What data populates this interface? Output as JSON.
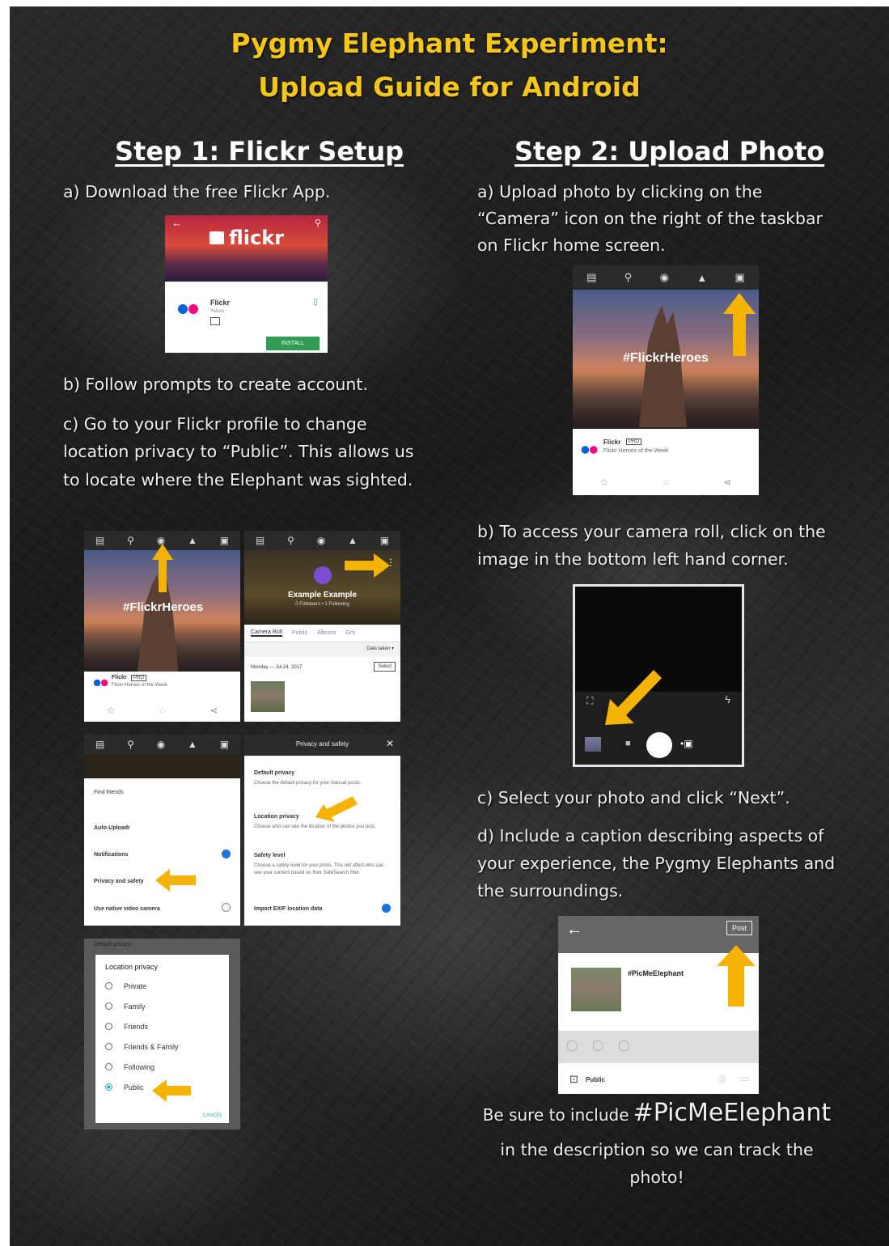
{
  "title": {
    "line1": "Pygmy Elephant Experiment:",
    "line2": "Upload Guide for Android"
  },
  "step1": {
    "heading": "Step 1: Flickr Setup",
    "a": "a) Download the free Flickr App.",
    "b": "b) Follow prompts to create account.",
    "c_lines": [
      "c) Go to your Flickr profile to change",
      "location privacy to “Public”. This allows us",
      "to locate where the Elephant was sighted."
    ],
    "app_store": {
      "logo": "flickr",
      "app_name": "Flickr",
      "publisher": "Yahoo",
      "install": "INSTALL"
    },
    "feed": {
      "hashtag": "#FlickrHeroes",
      "account": "Flickr",
      "badge": "PRO",
      "subtitle": "Flickr Heroes of the Week"
    },
    "profile": {
      "name": "Example Example",
      "stats": "0 Followers • 1 Following",
      "tabs": [
        "Camera Roll",
        "Public",
        "Albums",
        "Gro"
      ],
      "sort": "Date taken ▾",
      "date": "Monday — Jul 24, 2017",
      "select": "Select"
    },
    "menu": {
      "items": [
        "Find friends",
        "Auto-Uploadr",
        "Notifications",
        "Privacy and safety",
        "Use native video camera"
      ]
    },
    "privacy": {
      "header": "Privacy and safety",
      "default_title": "Default privacy",
      "default_desc": "Choose the default privacy for your manual posts.",
      "location_title": "Location privacy",
      "location_desc": "Choose who can see the location of the photos you post.",
      "safety_title": "Safety level",
      "safety_desc": "Choose a safety level for your posts. This will affect who can see your content based on their SafeSearch filter.",
      "exif": "Import EXIF location data"
    },
    "location_dialog": {
      "backdrop": "Default privacy",
      "title": "Location privacy",
      "options": [
        "Private",
        "Family",
        "Friends",
        "Friends & Family",
        "Following",
        "Public"
      ],
      "selected": "Public",
      "cancel": "CANCEL"
    }
  },
  "step2": {
    "heading": "Step 2: Upload Photo",
    "a_lines": [
      "a) Upload photo by clicking on the",
      "“Camera” icon on the right of the taskbar",
      "on Flickr home screen."
    ],
    "b_lines": [
      "b) To access your camera roll, click on the",
      "image in the bottom left hand corner."
    ],
    "c": "c) Select your photo and click “Next”.",
    "d_lines": [
      "d) Include a caption describing aspects of",
      "your experience, the Pygmy Elephants and",
      "the surroundings."
    ],
    "home": {
      "hashtag": "#FlickrHeroes",
      "account": "Flickr",
      "badge": "PRO",
      "subtitle": "Flickr Heroes of the Week"
    },
    "post": {
      "post_button": "Post",
      "caption": "#PicMeElephant",
      "visibility": "Public"
    },
    "reminder": {
      "prefix": "Be sure to include",
      "tag": "#PicMeElephant",
      "line2": "in the description so we can track the",
      "line3": "photo!"
    }
  },
  "colors": {
    "accent": "#f5c518",
    "arrow": "#f5b301",
    "flickr_blue": "#0063dc",
    "flickr_pink": "#ff0084",
    "install_green": "#2e9d53"
  }
}
